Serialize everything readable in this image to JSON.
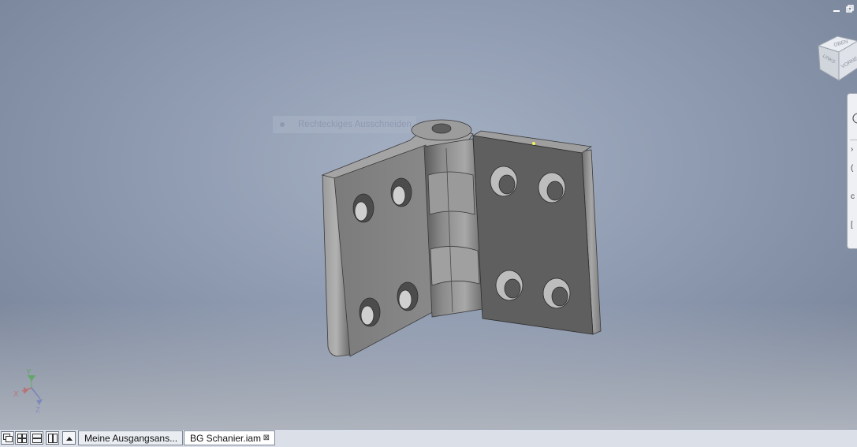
{
  "viewport": {
    "tooltip_text": "Rechteckiges Ausschneiden"
  },
  "window_controls": {
    "minimize_icon": "minimize-icon",
    "restore_icon": "restore-icon"
  },
  "viewcube": {
    "top_face": "OBEN",
    "front_face": "VORNE",
    "left_face": "LINKS"
  },
  "triad": {
    "x": "X",
    "y": "Y",
    "z": "Z"
  },
  "tabbar": {
    "layout_buttons": [
      "cascade-icon",
      "tile-grid-icon",
      "tile-horizontal-icon",
      "tile-vertical-icon"
    ],
    "scroll_up_icon": "triangle-up-icon",
    "tabs": [
      {
        "label": "Meine Ausgangsans..."
      },
      {
        "label": "BG Schanier.iam",
        "close": "⊠"
      }
    ]
  }
}
